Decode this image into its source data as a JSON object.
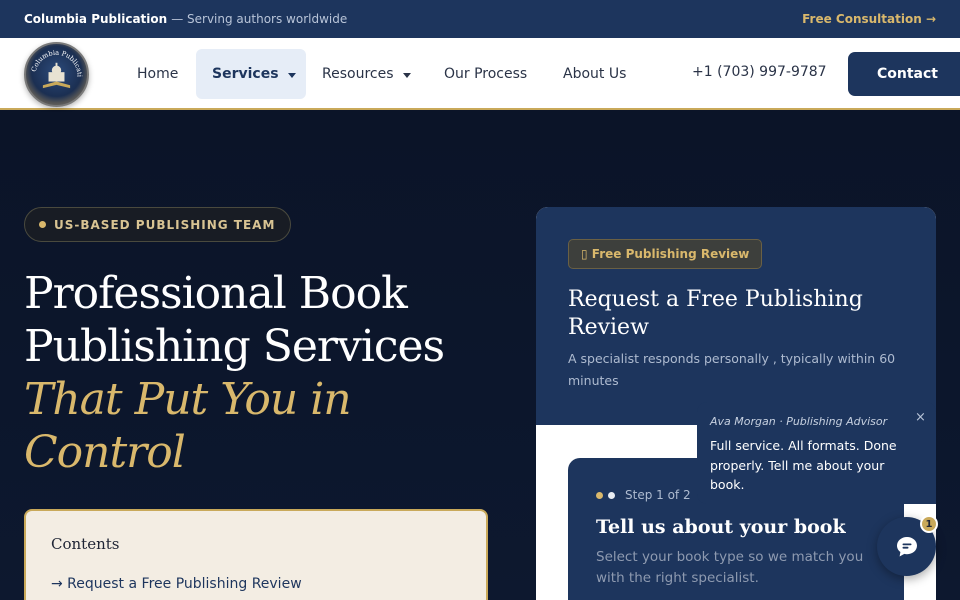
{
  "topbar": {
    "brand": "Columbia Publication",
    "tagline": "— Serving authors worldwide",
    "consult_label": "Free Consultation →"
  },
  "nav": {
    "logo_text": "Columbia Publication",
    "items": [
      {
        "label": "Home"
      },
      {
        "label": "Services",
        "has_dropdown": true,
        "active": true
      },
      {
        "label": "Resources",
        "has_dropdown": true
      },
      {
        "label": "Our Process"
      },
      {
        "label": "About Us"
      }
    ],
    "phone": "+1 (703) 997-9787",
    "contact_label": "Contact"
  },
  "hero": {
    "badge": "US-BASED PUBLISHING TEAM",
    "title_line1": "Professional Book",
    "title_line2": "Publishing Services",
    "title_gold_line1": "That Put You in",
    "title_gold_line2": "Control"
  },
  "contents": {
    "title": "Contents",
    "link": "→ Request a Free Publishing Review"
  },
  "form_card": {
    "pill": "▯ Free Publishing Review",
    "title": "Request a Free Publishing Review",
    "subtitle": "A specialist responds personally , typically within 60 minutes",
    "step_label": "Step 1 of 2",
    "step_title": "Tell us about your book",
    "step_subtitle": "Select your book type so we match you with the right specialist."
  },
  "chat": {
    "agent": "Ava Morgan · Publishing Advisor",
    "message": "Full service. All formats. Done properly. Tell me about your book.",
    "close": "×",
    "unread": "1"
  },
  "colors": {
    "navy": "#1d355d",
    "gold": "#d9b86c",
    "hero_bg": "#0b1428",
    "cream": "#f3ede3"
  }
}
